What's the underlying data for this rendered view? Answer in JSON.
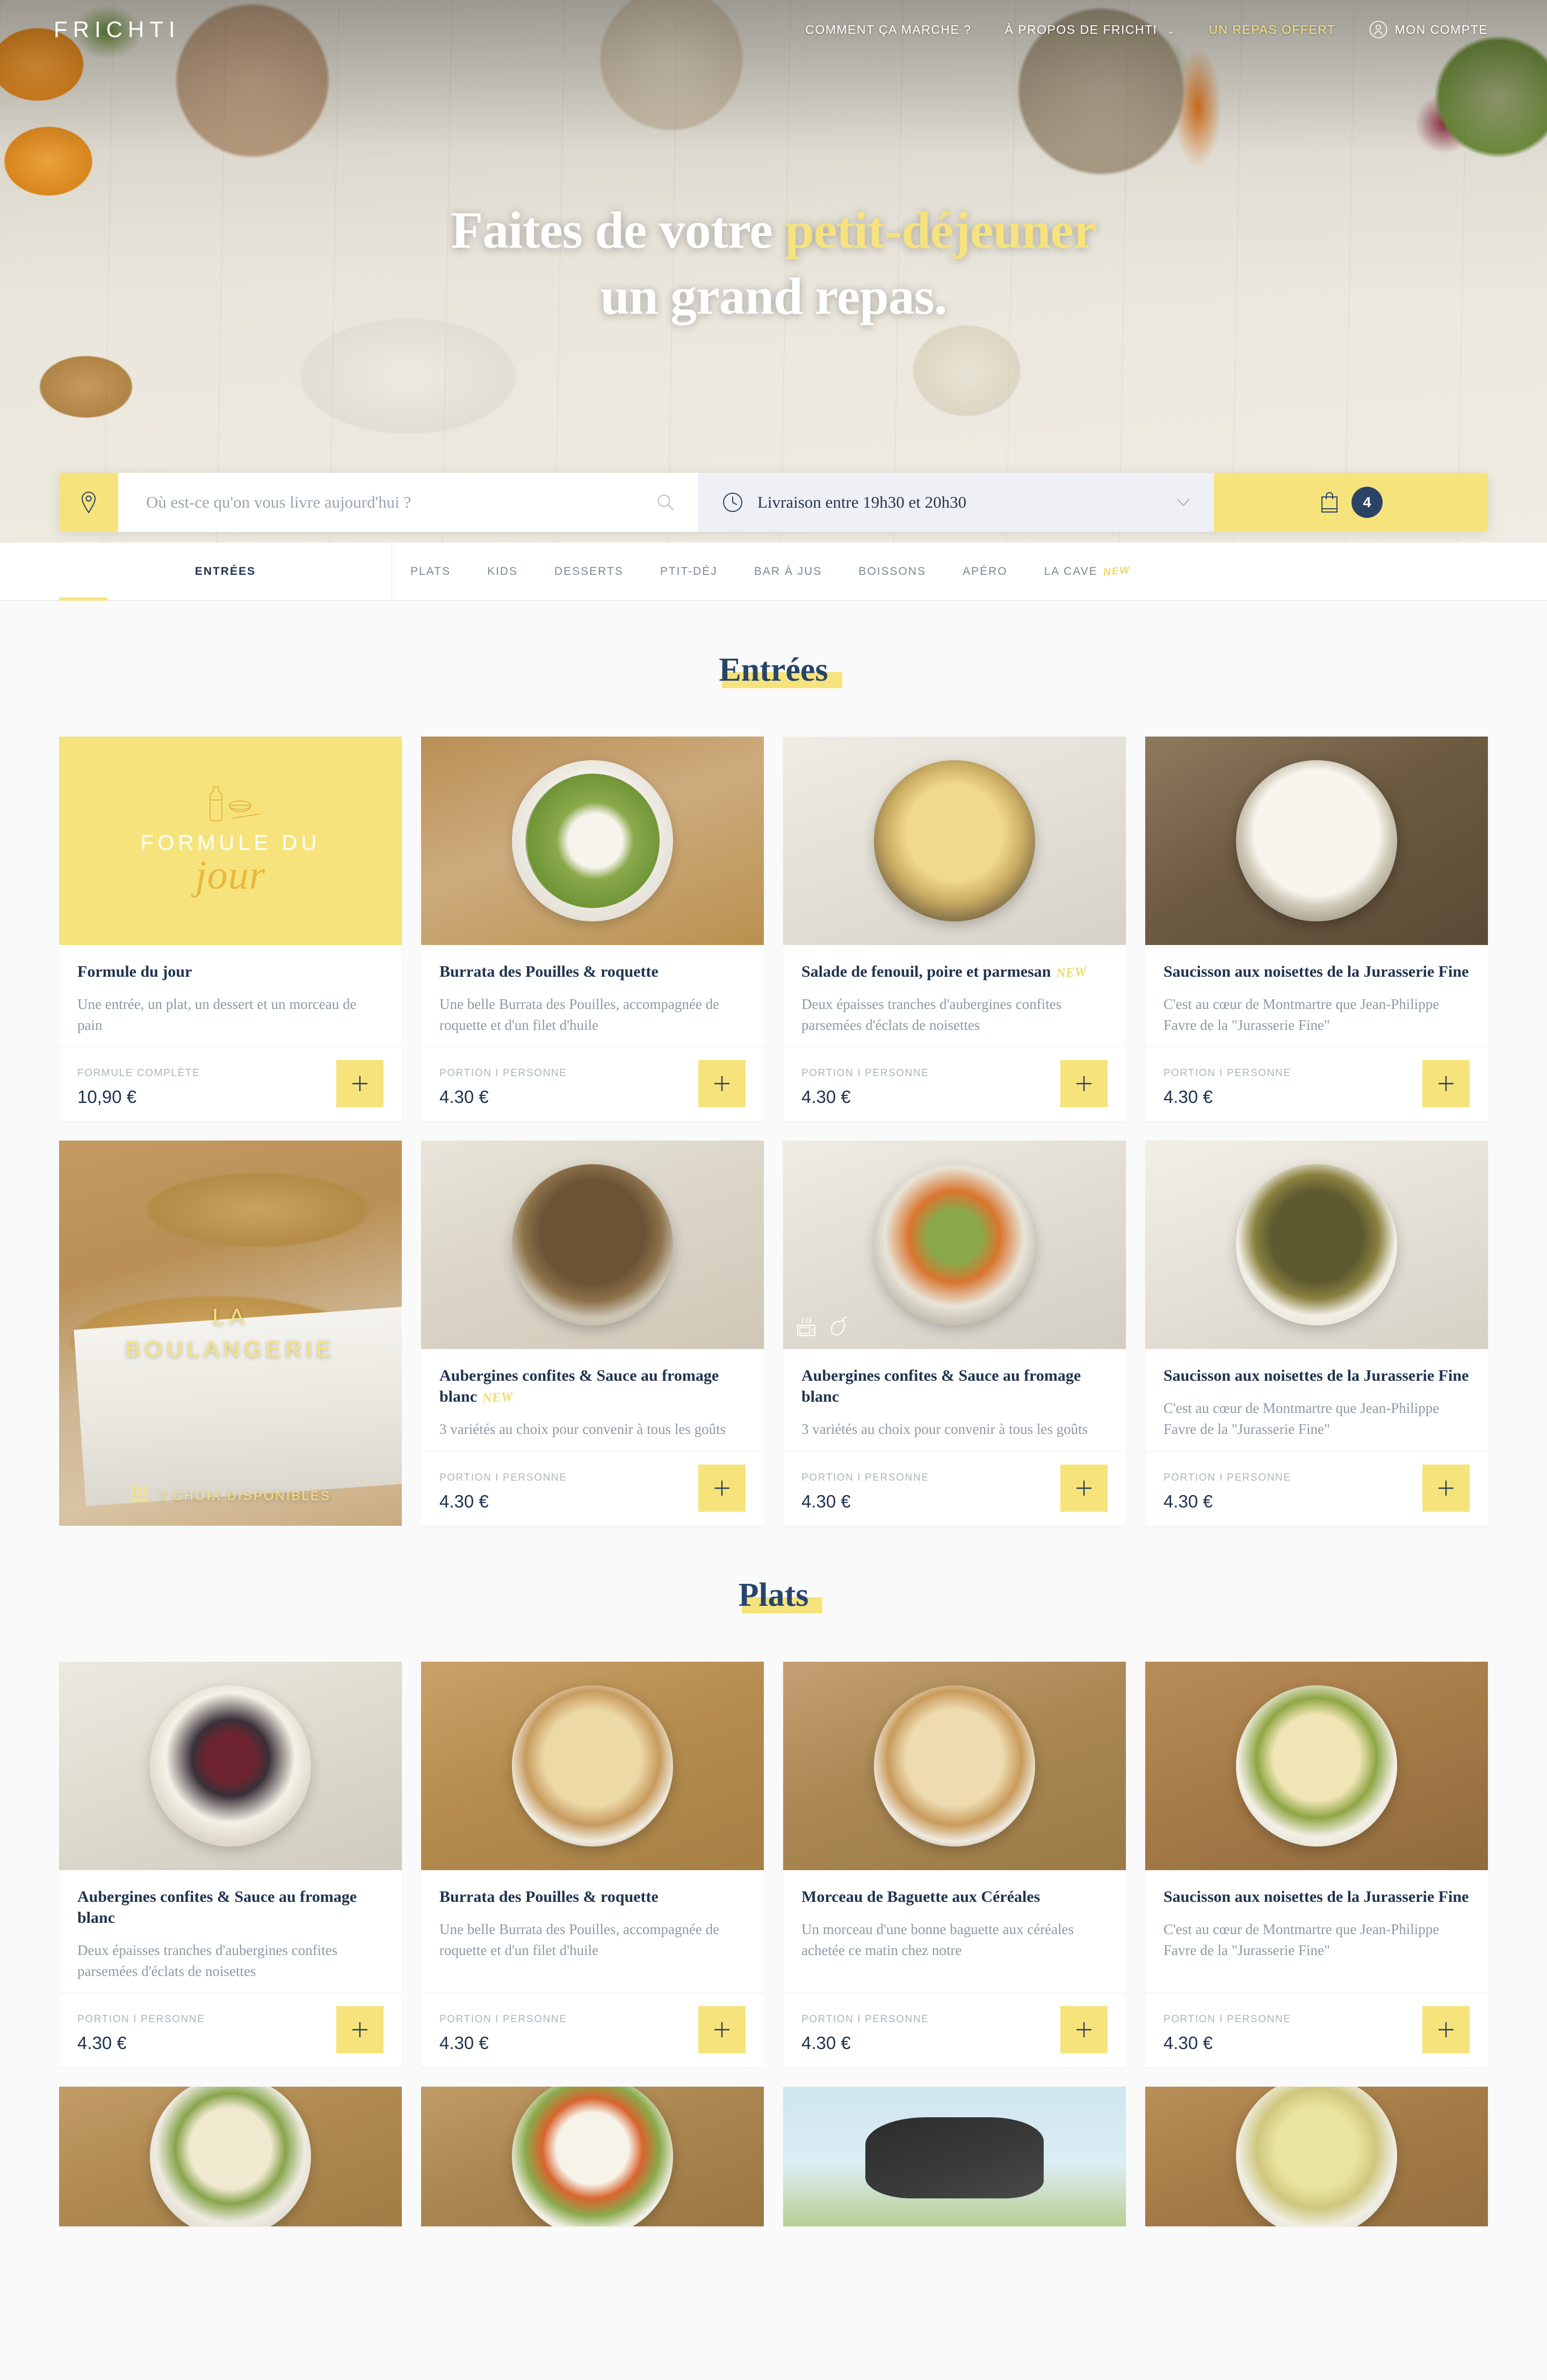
{
  "header": {
    "brand": "FRICHTI",
    "nav": [
      {
        "label": "COMMENT ÇA MARCHE ?",
        "accent": false
      },
      {
        "label": "À PROPOS DE FRICHTI",
        "accent": false,
        "caret": "⌄"
      },
      {
        "label": "UN REPAS OFFERT",
        "accent": true
      }
    ],
    "account_label": "MON COMPTE",
    "account_icon": "user-circle-icon"
  },
  "hero": {
    "title_part1": "Faites de votre ",
    "title_highlight": "petit-déjeuner",
    "title_part2": "un grand repas."
  },
  "search": {
    "pin_icon": "location-pin-icon",
    "placeholder": "Où est-ce qu'on vous livre aujourd'hui ?",
    "value": "",
    "search_icon": "search-icon",
    "clock_icon": "clock-icon",
    "delivery_label": "Livraison entre 19h30 et 20h30",
    "chevron_icon": "chevron-down-icon",
    "cart_icon": "shopping-bag-icon",
    "cart_count": "4"
  },
  "tabs": [
    {
      "label": "ENTRÉES",
      "active": true
    },
    {
      "label": "PLATS",
      "active": false
    },
    {
      "label": "KIDS",
      "active": false
    },
    {
      "label": "DESSERTS",
      "active": false
    },
    {
      "label": "PTIT-DÉJ",
      "active": false
    },
    {
      "label": "BAR À JUS",
      "active": false
    },
    {
      "label": "BOISSONS",
      "active": false
    },
    {
      "label": "APÉRO",
      "active": false
    },
    {
      "label": "LA CAVE",
      "active": false,
      "badge": "NEW"
    }
  ],
  "colors": {
    "yellow": "#f7e37c",
    "navy": "#1f3350",
    "muted": "#8f9aa6",
    "page_bg": "#fafafa"
  },
  "sections": [
    {
      "title": "Entrées",
      "rows": [
        [
          {
            "kind": "promo_formule",
            "promo_icon": "bottle-bowl-icon",
            "promo_line1": "FORMULE DU",
            "promo_line2": "jour",
            "title": "Formule du jour",
            "desc": "Une entrée, un plat, un dessert et un morceau de pain",
            "portion": "FORMULE COMPLÈTE",
            "price": "10,90 €",
            "add_icon": "plus-icon"
          },
          {
            "kind": "product",
            "photo": "burrata",
            "title": "Burrata des Pouilles & roquette",
            "badge": "",
            "desc": "Une belle Burrata des Pouilles, accompagnée de roquette et d'un filet d'huile",
            "portion": "PORTION I PERSONNE",
            "price": "4.30 €",
            "add_icon": "plus-icon"
          },
          {
            "kind": "product",
            "photo": "fenouil",
            "title": "Salade de fenouil, poire et parmesan",
            "badge": "NEW",
            "desc": "Deux épaisses tranches d'aubergines confites parsemées d'éclats de noisettes",
            "portion": "PORTION I PERSONNE",
            "price": "4.30 €",
            "add_icon": "plus-icon"
          },
          {
            "kind": "product",
            "photo": "soup",
            "title": "Saucisson aux noisettes de la Jurasserie Fine",
            "badge": "",
            "desc": "C'est au cœur de Montmartre que Jean-Philippe Favre de la \"Jurasserie Fine\"",
            "portion": "PORTION I PERSONNE",
            "price": "4.30 €",
            "add_icon": "plus-icon"
          }
        ],
        [
          {
            "kind": "promo_boulangerie",
            "promo_line1": "LA",
            "promo_line2": "BOULANGERIE",
            "grid_icon": "grid-icon",
            "choices": "7 CHOIX DISPONIBLES"
          },
          {
            "kind": "product",
            "photo": "mushroom",
            "title": "Aubergines confites & Sauce au fromage blanc",
            "badge": "NEW",
            "desc": "3 variétés au choix pour convenir à tous les goûts",
            "portion": "PORTION I PERSONNE",
            "price": "4.30 €",
            "add_icon": "plus-icon"
          },
          {
            "kind": "product",
            "photo": "veggiebowl",
            "title": "Aubergines confites & Sauce au fromage blanc",
            "badge": "",
            "desc": "3 variétés au choix pour convenir à tous les goûts",
            "portion": "PORTION I PERSONNE",
            "price": "4.30 €",
            "add_icon": "plus-icon",
            "badges": [
              "microwave-icon",
              "chili-pepper-icon"
            ]
          },
          {
            "kind": "product",
            "photo": "lentils",
            "title": "Saucisson aux noisettes de la Jurasserie Fine",
            "badge": "",
            "desc": "C'est au cœur de Montmartre que Jean-Philippe Favre de la \"Jurasserie Fine\"",
            "portion": "PORTION I PERSONNE",
            "price": "4.30 €",
            "add_icon": "plus-icon"
          }
        ]
      ]
    },
    {
      "title": "Plats",
      "rows": [
        [
          {
            "kind": "product",
            "photo": "meatballs",
            "title": "Aubergines confites & Sauce au fromage blanc",
            "badge": "",
            "desc": "Deux épaisses tranches d'aubergines confites parsemées d'éclats de noisettes",
            "portion": "PORTION I PERSONNE",
            "price": "4.30 €",
            "add_icon": "plus-icon"
          },
          {
            "kind": "product",
            "photo": "carbonara",
            "title": "Burrata des Pouilles & roquette",
            "badge": "",
            "desc": "Une belle Burrata des Pouilles, accompagnée de roquette et d'un filet d'huile",
            "portion": "PORTION I PERSONNE",
            "price": "4.30 €",
            "add_icon": "plus-icon"
          },
          {
            "kind": "product",
            "photo": "carbonara2",
            "title": "Morceau de Baguette aux Céréales",
            "badge": "",
            "desc": "Un morceau d'une bonne baguette aux céréales achetée ce matin chez notre",
            "portion": "PORTION I PERSONNE",
            "price": "4.30 €",
            "add_icon": "plus-icon"
          },
          {
            "kind": "product",
            "photo": "tagliatelle",
            "title": "Saucisson aux noisettes de la Jurasserie Fine",
            "badge": "",
            "desc": "C'est au cœur de Montmartre que Jean-Philippe Favre de la \"Jurasserie Fine\"",
            "portion": "PORTION I PERSONNE",
            "price": "4.30 €",
            "add_icon": "plus-icon"
          }
        ],
        [
          {
            "kind": "photo_only",
            "photo": "pasta_peas"
          },
          {
            "kind": "photo_only",
            "photo": "thai_noodles"
          },
          {
            "kind": "photo_only",
            "photo": "cow"
          },
          {
            "kind": "photo_only",
            "photo": "fish_leek"
          }
        ]
      ]
    }
  ]
}
